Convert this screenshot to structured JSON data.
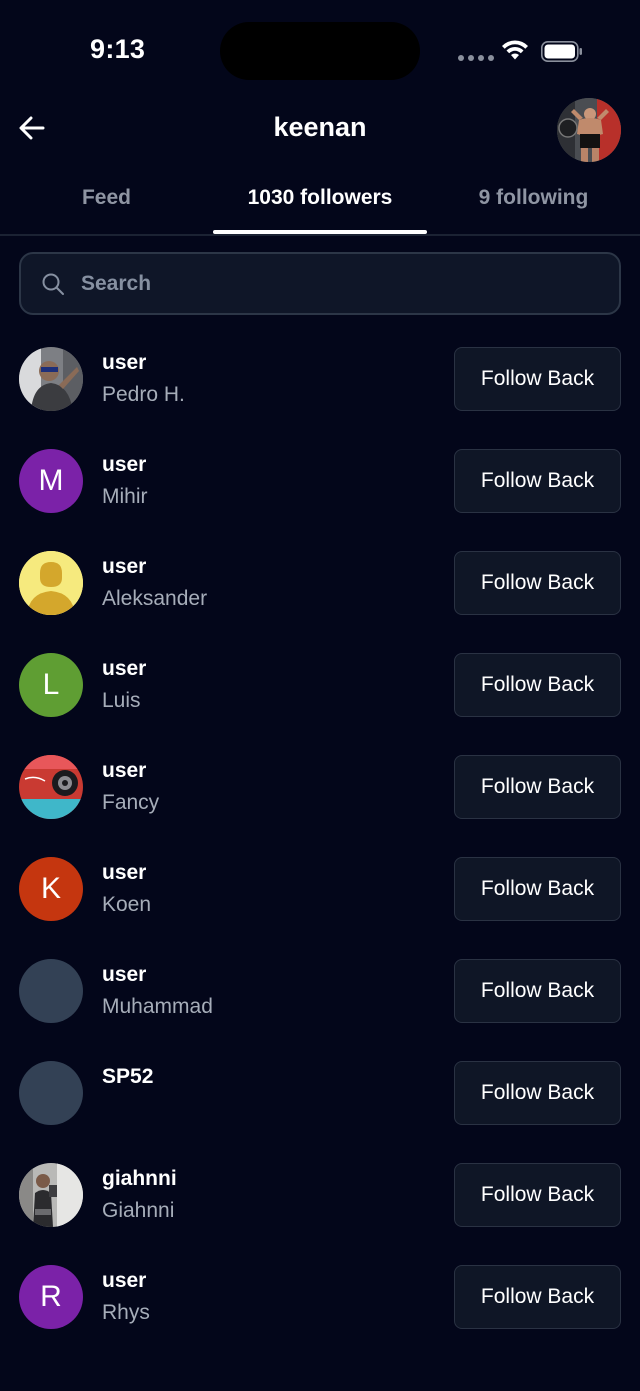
{
  "status_bar": {
    "time": "9:13"
  },
  "header": {
    "title": "keenan"
  },
  "tabs": [
    {
      "label": "Feed",
      "active": false
    },
    {
      "label": "1030 followers",
      "active": true
    },
    {
      "label": "9 following",
      "active": false
    }
  ],
  "search": {
    "placeholder": "Search",
    "value": ""
  },
  "followers": [
    {
      "username": "user",
      "display_name": "Pedro H.",
      "avatar_type": "photo",
      "avatar_letter": "",
      "avatar_color": "#6b6f78",
      "button": "Follow Back"
    },
    {
      "username": "user",
      "display_name": "Mihir",
      "avatar_type": "letter",
      "avatar_letter": "M",
      "avatar_color": "#7b22a8",
      "button": "Follow Back"
    },
    {
      "username": "user",
      "display_name": "Aleksander",
      "avatar_type": "placeholder",
      "avatar_letter": "",
      "avatar_color": "#f6ea7e",
      "button": "Follow Back"
    },
    {
      "username": "user",
      "display_name": "Luis",
      "avatar_type": "letter",
      "avatar_letter": "L",
      "avatar_color": "#5f9e33",
      "button": "Follow Back"
    },
    {
      "username": "user",
      "display_name": "Fancy",
      "avatar_type": "photo",
      "avatar_letter": "",
      "avatar_color": "#c93a32",
      "button": "Follow Back"
    },
    {
      "username": "user",
      "display_name": "Koen",
      "avatar_type": "letter",
      "avatar_letter": "K",
      "avatar_color": "#c5360f",
      "button": "Follow Back"
    },
    {
      "username": "user",
      "display_name": "Muhammad",
      "avatar_type": "blank",
      "avatar_letter": "",
      "avatar_color": "#334155",
      "button": "Follow Back"
    },
    {
      "username": "SP52",
      "display_name": "",
      "avatar_type": "blank",
      "avatar_letter": "",
      "avatar_color": "#334155",
      "button": "Follow Back"
    },
    {
      "username": "giahnni",
      "display_name": "Giahnni",
      "avatar_type": "photo",
      "avatar_letter": "",
      "avatar_color": "#9a9a9a",
      "button": "Follow Back"
    },
    {
      "username": "user",
      "display_name": "Rhys",
      "avatar_type": "letter",
      "avatar_letter": "R",
      "avatar_color": "#7b22a8",
      "button": "Follow Back"
    }
  ]
}
